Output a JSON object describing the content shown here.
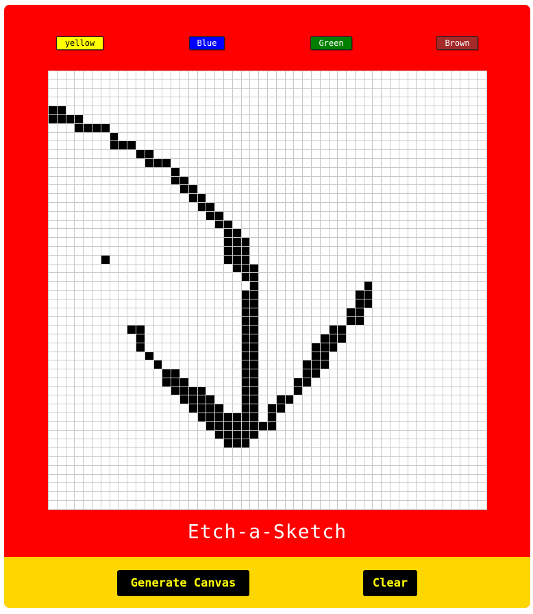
{
  "colors": {
    "frame": "#ff0000",
    "footer": "#ffd700",
    "pen": "#000000"
  },
  "palette": [
    {
      "label": "yellow",
      "color": "#ffff00"
    },
    {
      "label": "Blue",
      "color": "#0000ff"
    },
    {
      "label": "Green",
      "color": "#008000"
    },
    {
      "label": "Brown",
      "color": "#a52a2a"
    }
  ],
  "title": "Etch-a-Sketch",
  "footer": {
    "generate_label": "Generate Canvas",
    "clear_label": "Clear"
  },
  "canvas": {
    "grid_size": 50,
    "painted_cells": [
      [
        4,
        0
      ],
      [
        4,
        1
      ],
      [
        5,
        0
      ],
      [
        5,
        1
      ],
      [
        5,
        2
      ],
      [
        5,
        3
      ],
      [
        6,
        3
      ],
      [
        6,
        4
      ],
      [
        6,
        5
      ],
      [
        6,
        6
      ],
      [
        7,
        7
      ],
      [
        8,
        7
      ],
      [
        8,
        8
      ],
      [
        8,
        9
      ],
      [
        9,
        10
      ],
      [
        9,
        11
      ],
      [
        10,
        11
      ],
      [
        10,
        12
      ],
      [
        10,
        13
      ],
      [
        11,
        14
      ],
      [
        12,
        14
      ],
      [
        12,
        15
      ],
      [
        13,
        15
      ],
      [
        13,
        16
      ],
      [
        14,
        16
      ],
      [
        14,
        17
      ],
      [
        15,
        17
      ],
      [
        15,
        18
      ],
      [
        16,
        18
      ],
      [
        16,
        19
      ],
      [
        17,
        19
      ],
      [
        17,
        20
      ],
      [
        18,
        20
      ],
      [
        18,
        21
      ],
      [
        19,
        20
      ],
      [
        19,
        21
      ],
      [
        19,
        22
      ],
      [
        20,
        20
      ],
      [
        20,
        21
      ],
      [
        20,
        22
      ],
      [
        21,
        20
      ],
      [
        21,
        21
      ],
      [
        21,
        22
      ],
      [
        22,
        21
      ],
      [
        22,
        22
      ],
      [
        22,
        23
      ],
      [
        23,
        22
      ],
      [
        23,
        23
      ],
      [
        24,
        23
      ],
      [
        25,
        22
      ],
      [
        25,
        23
      ],
      [
        26,
        22
      ],
      [
        26,
        23
      ],
      [
        27,
        22
      ],
      [
        27,
        23
      ],
      [
        28,
        22
      ],
      [
        28,
        23
      ],
      [
        29,
        22
      ],
      [
        29,
        23
      ],
      [
        30,
        22
      ],
      [
        30,
        23
      ],
      [
        31,
        22
      ],
      [
        31,
        23
      ],
      [
        32,
        22
      ],
      [
        32,
        23
      ],
      [
        33,
        22
      ],
      [
        33,
        23
      ],
      [
        34,
        22
      ],
      [
        34,
        23
      ],
      [
        35,
        22
      ],
      [
        35,
        23
      ],
      [
        36,
        22
      ],
      [
        36,
        23
      ],
      [
        37,
        22
      ],
      [
        37,
        23
      ],
      [
        38,
        22
      ],
      [
        38,
        23
      ],
      [
        39,
        22
      ],
      [
        39,
        23
      ],
      [
        40,
        21
      ],
      [
        40,
        22
      ],
      [
        40,
        23
      ],
      [
        41,
        21
      ],
      [
        41,
        22
      ],
      [
        41,
        23
      ],
      [
        21,
        6
      ],
      [
        29,
        9
      ],
      [
        29,
        10
      ],
      [
        30,
        10
      ],
      [
        31,
        10
      ],
      [
        32,
        11
      ],
      [
        33,
        12
      ],
      [
        34,
        13
      ],
      [
        34,
        14
      ],
      [
        35,
        13
      ],
      [
        35,
        14
      ],
      [
        35,
        15
      ],
      [
        36,
        14
      ],
      [
        36,
        15
      ],
      [
        36,
        16
      ],
      [
        36,
        17
      ],
      [
        37,
        15
      ],
      [
        37,
        16
      ],
      [
        37,
        17
      ],
      [
        37,
        18
      ],
      [
        38,
        16
      ],
      [
        38,
        17
      ],
      [
        38,
        18
      ],
      [
        38,
        19
      ],
      [
        39,
        17
      ],
      [
        39,
        18
      ],
      [
        39,
        19
      ],
      [
        39,
        20
      ],
      [
        39,
        21
      ],
      [
        40,
        18
      ],
      [
        40,
        19
      ],
      [
        40,
        20
      ],
      [
        41,
        19
      ],
      [
        41,
        20
      ],
      [
        42,
        20
      ],
      [
        42,
        21
      ],
      [
        42,
        22
      ],
      [
        24,
        36
      ],
      [
        25,
        35
      ],
      [
        25,
        36
      ],
      [
        26,
        35
      ],
      [
        26,
        36
      ],
      [
        27,
        34
      ],
      [
        27,
        35
      ],
      [
        28,
        34
      ],
      [
        28,
        35
      ],
      [
        29,
        32
      ],
      [
        29,
        33
      ],
      [
        30,
        31
      ],
      [
        30,
        32
      ],
      [
        30,
        33
      ],
      [
        31,
        30
      ],
      [
        31,
        31
      ],
      [
        31,
        32
      ],
      [
        32,
        30
      ],
      [
        32,
        31
      ],
      [
        33,
        29
      ],
      [
        33,
        30
      ],
      [
        33,
        31
      ],
      [
        34,
        29
      ],
      [
        34,
        30
      ],
      [
        35,
        28
      ],
      [
        35,
        29
      ],
      [
        36,
        28
      ],
      [
        37,
        26
      ],
      [
        37,
        27
      ],
      [
        38,
        25
      ],
      [
        38,
        26
      ],
      [
        39,
        25
      ],
      [
        40,
        24
      ],
      [
        40,
        25
      ]
    ]
  }
}
